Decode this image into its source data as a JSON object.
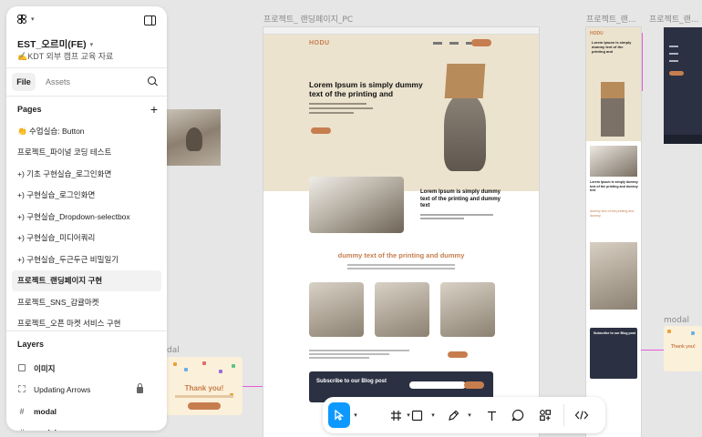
{
  "panel": {
    "file_title": "EST_오르미(FE)",
    "file_subtitle": "✍️KDT 외부 캠프 교육 자료",
    "tabs": {
      "file": "File",
      "assets": "Assets"
    },
    "pages_title": "Pages",
    "pages": [
      "👏 수업실습: Button",
      "프로젝트_파이널 코딩 테스트",
      "+) 기초 구현실습_로그인화면",
      "+) 구현실습_로그인화면",
      "+) 구현실습_Dropdown-selectbox",
      "+) 구현실습_미디어쿼리",
      "+) 구현실습_두근두근 비밀일기",
      "프로젝트_랜딩페이지 구현",
      "프로젝트_SNS_감귤마켓",
      "프로젝트_오픈 마켓 서비스 구현"
    ],
    "active_page_index": 7,
    "layers_title": "Layers",
    "layers": [
      {
        "name": "이미지",
        "icon": "image-icon",
        "bold": true
      },
      {
        "name": "Updating Arrows",
        "icon": "rect-icon",
        "bold": false,
        "locked": true
      },
      {
        "name": "modal",
        "icon": "frame-icon",
        "bold": true
      },
      {
        "name": "modal",
        "icon": "frame-icon",
        "bold": true
      }
    ]
  },
  "canvas": {
    "frame_labels": {
      "landing_pc": "프로젝트_ 랜딩페이지_PC",
      "right_1": "프로젝트_랜...",
      "right_2": "프로젝트_랜...",
      "modal_left": "dal",
      "modal_right": "modal"
    },
    "landing": {
      "logo": "HODU",
      "hero_heading": "Lorem Ipsum is simply dummy text of the printing and",
      "section_heading": "Lorem Ipsum is simply dummy text of the printing and dummy text",
      "section3_heading": "dummy text of the printing and dummy",
      "subscribe_title": "Subscribe to our Blog post"
    },
    "mobile": {
      "logo": "HODU",
      "hero_heading": "Lorem Ipsum is simply dummy text of the printing and",
      "section_heading": "Lorem Ipsum is simply dummy text of the printing and dummy text",
      "section3_heading": "dummy text of the printing and dummy",
      "subscribe_title": "Subscribe to our Blog post"
    },
    "modal_title": "Thank you!"
  },
  "toolbar": {
    "tools": [
      "move-tool",
      "frame-tool",
      "shape-tool",
      "pen-tool",
      "text-tool",
      "comment-tool",
      "actions-tool",
      "dev-mode-toggle"
    ]
  },
  "colors": {
    "accent": "#0d99ff",
    "brand": "#c77e4f",
    "pink": "#e85ad6"
  }
}
